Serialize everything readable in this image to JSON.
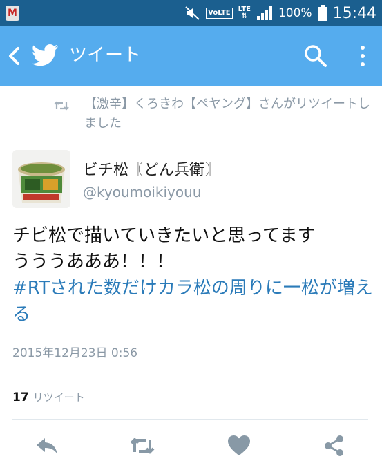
{
  "status_bar": {
    "app_icon_letter": "M",
    "volte": "VoLTE",
    "lte": "LTE",
    "battery": "100%",
    "time": "15:44"
  },
  "toolbar": {
    "title": "ツイート",
    "icons": [
      "back-arrow-icon",
      "twitter-bird-icon",
      "search-icon",
      "more-vert-icon"
    ]
  },
  "retweet_note": {
    "text": "【激辛】くろきわ【ペヤング】さんがリツイートしました",
    "icon": "retweet-icon"
  },
  "tweet": {
    "author_name": "ビチ松〖どん兵衛〗",
    "author_handle": "@kyoumoikiyouu",
    "text_line1": "チビ松で描いていきたいと思ってます",
    "text_line2": "うううあああ！！！",
    "hashtag_text": "#RTされた数だけカラ松の周りに一松が増える",
    "date": "2015年12月23日 0:56",
    "retweet_count": "17",
    "retweet_label": "リツイート"
  },
  "actions": [
    "reply-icon",
    "retweet-icon",
    "like-heart-icon",
    "share-icon"
  ],
  "colors": {
    "status_bar": "#1b5f8f",
    "toolbar": "#55acee",
    "hashtag": "#2b7bb9",
    "muted_text": "#8b99a6",
    "action_icon": "#8899a6"
  }
}
